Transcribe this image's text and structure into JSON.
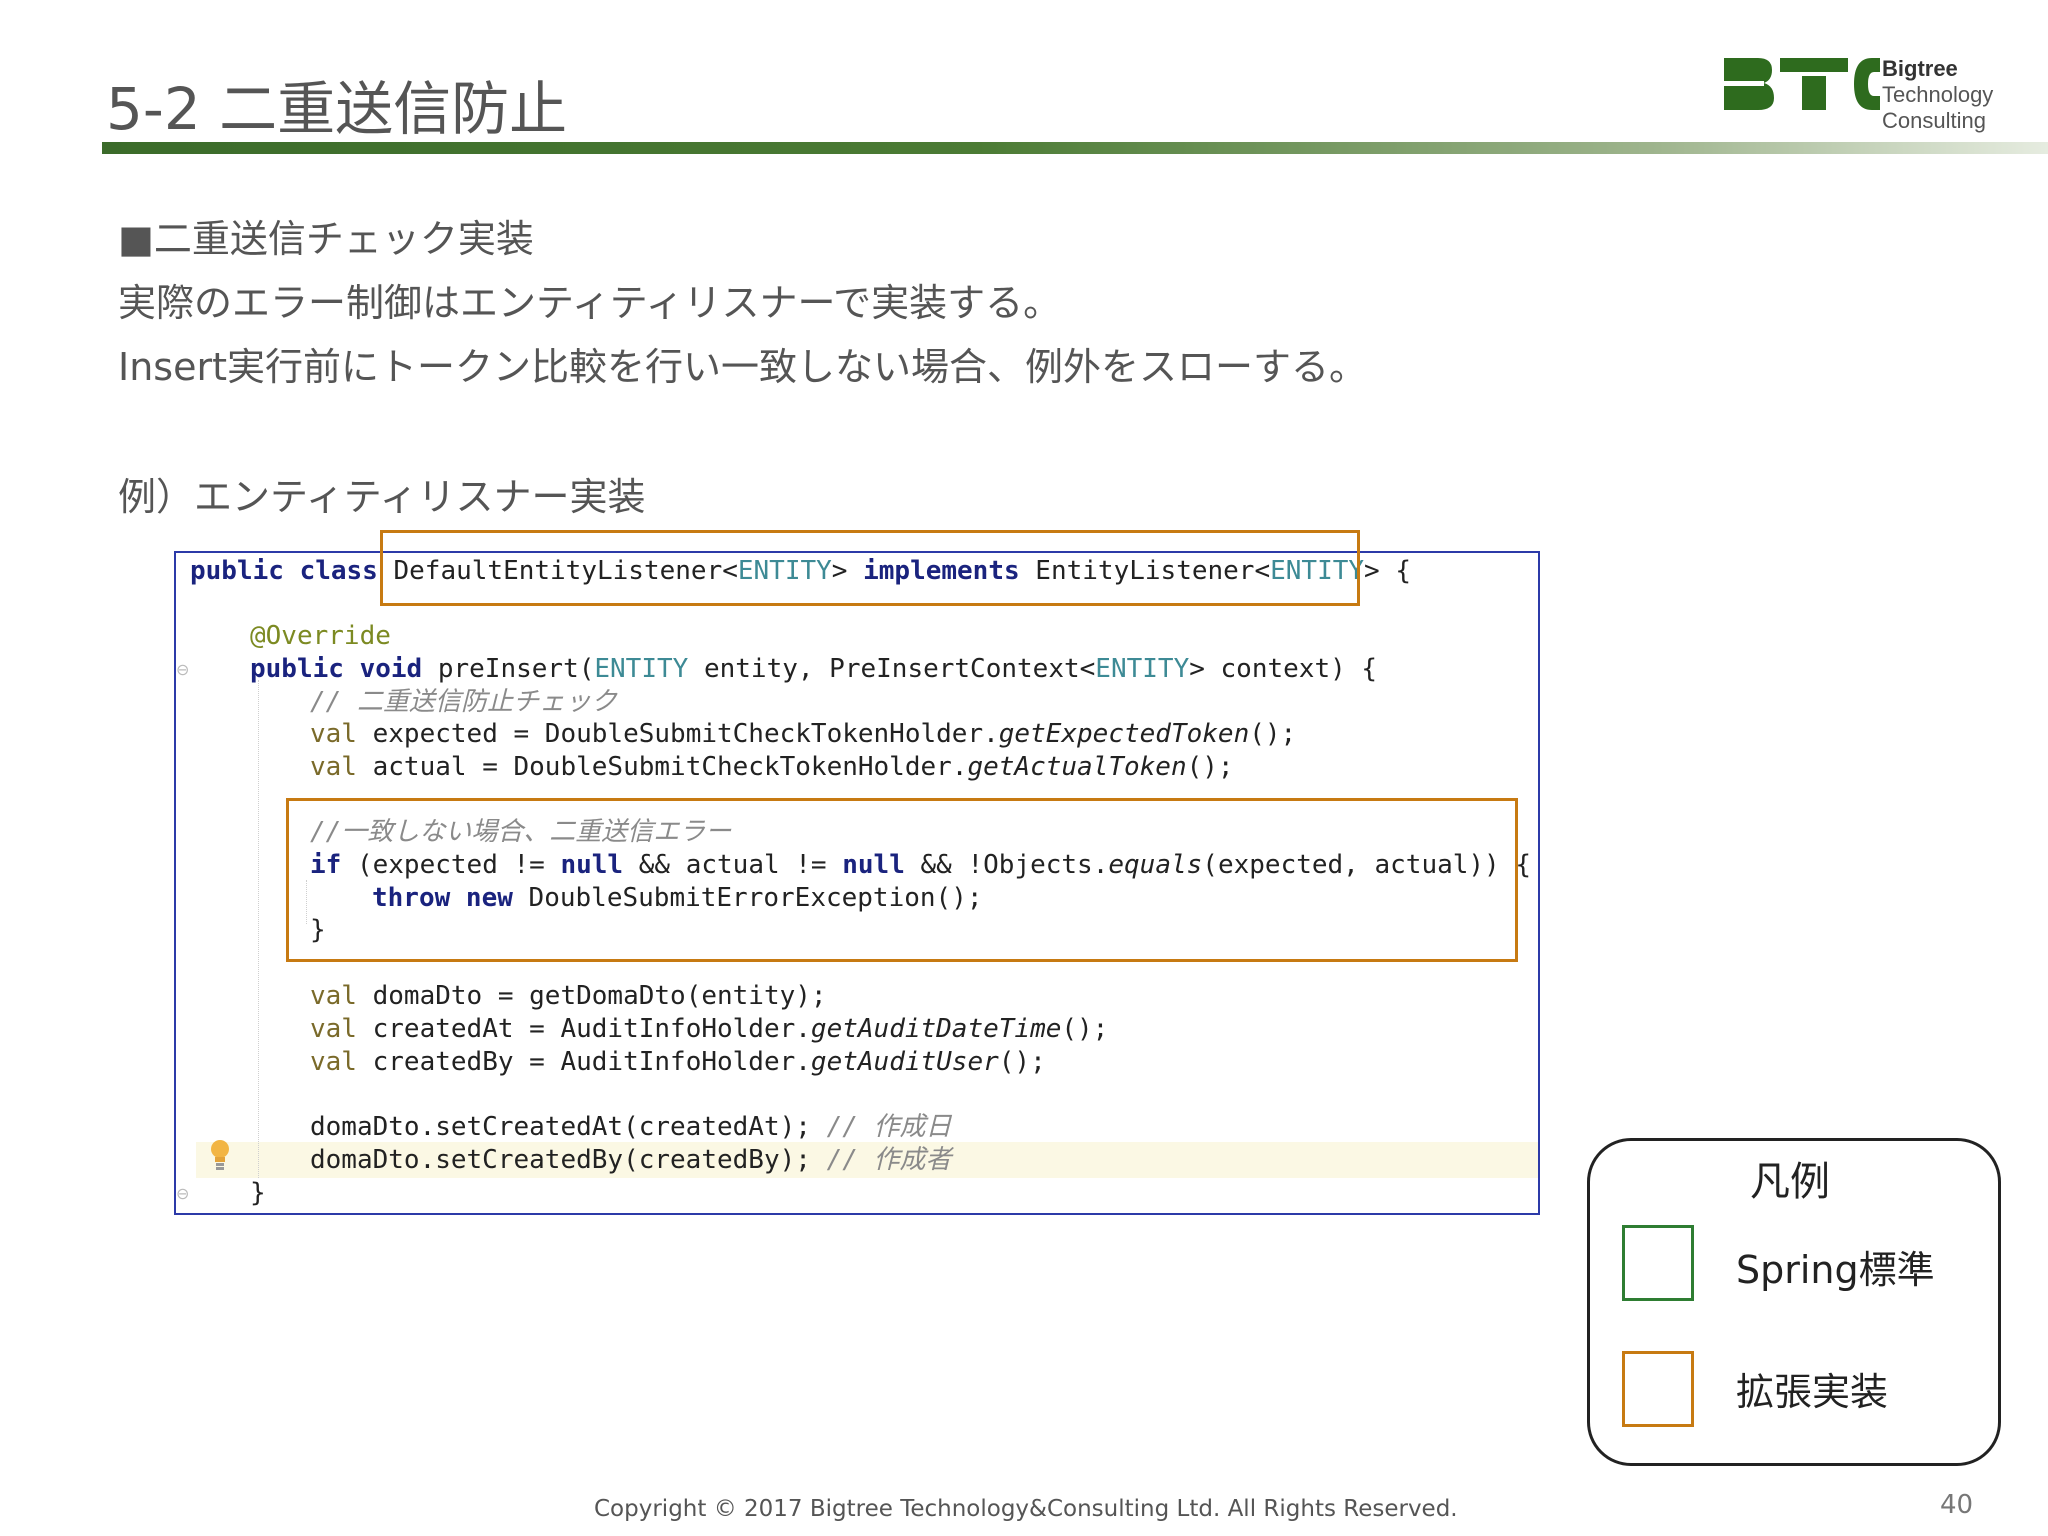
{
  "header": {
    "title": "5-2 二重送信防止",
    "logo": {
      "line1": "Bigtree",
      "line2": "Technology",
      "line3": "Consulting",
      "colors": {
        "green": "#2e6b1e"
      }
    }
  },
  "content": {
    "heading": "■二重送信チェック実装",
    "line1": "実際のエラー制御はエンティティリスナーで実装する。",
    "line2": "Insert実行前にトークン比較を行い一致しない場合、例外をスローする。",
    "example_label": "例）エンティティリスナー実装"
  },
  "code": {
    "l1": {
      "kw1": "public class",
      "cls": "DefaultEntityListener<",
      "t1": "ENTITY",
      "g1": "> ",
      "kw2": "implements",
      "cls2": " EntityListener<",
      "t2": "ENTITY",
      "g2": "> {"
    },
    "l2": {
      "ann": "@Override"
    },
    "l3": {
      "kw": "public void",
      "m": " preInsert(",
      "t1": "ENTITY",
      "a": " entity, PreInsertContext<",
      "t2": "ENTITY",
      "b": "> context) {"
    },
    "l4": {
      "cm": "// 二重送信防止チェック"
    },
    "l5": {
      "v": "val",
      "a": " expected = DoubleSubmitCheckTokenHolder.",
      "it": "getExpectedToken",
      "b": "();"
    },
    "l6": {
      "v": "val",
      "a": " actual = DoubleSubmitCheckTokenHolder.",
      "it": "getActualToken",
      "b": "();"
    },
    "l7": {
      "cm": "//一致しない場合、二重送信エラー"
    },
    "l8": {
      "kw1": "if",
      "a": " (expected != ",
      "kw2": "null",
      "b": " && actual != ",
      "kw3": "null",
      "c": " && !Objects.",
      "it": "equals",
      "d": "(expected, actual)) {"
    },
    "l9": {
      "kw1": "throw",
      "kw2": " new",
      "a": " DoubleSubmitErrorException();"
    },
    "l10": {
      "a": "}"
    },
    "l11": {
      "v": "val",
      "a": " domaDto = getDomaDto(entity);"
    },
    "l12": {
      "v": "val",
      "a": " createdAt = AuditInfoHolder.",
      "it": "getAuditDateTime",
      "b": "();"
    },
    "l13": {
      "v": "val",
      "a": " createdBy = AuditInfoHolder.",
      "it": "getAuditUser",
      "b": "();"
    },
    "l14": {
      "a": "domaDto.setCreatedAt(createdAt); ",
      "cm": "// 作成日"
    },
    "l15": {
      "a": "domaDto.setCreatedBy(createdBy); ",
      "cm": "// 作成者"
    },
    "l16": {
      "a": "}"
    }
  },
  "legend": {
    "title": "凡例",
    "items": [
      {
        "label": "Spring標準",
        "color": "#2e7d32"
      },
      {
        "label": "拡張実装",
        "color": "#c77a12"
      }
    ]
  },
  "footer": {
    "copyright": "Copyright © 2017 Bigtree Technology&Consulting Ltd. All Rights Reserved.",
    "page": "40"
  }
}
